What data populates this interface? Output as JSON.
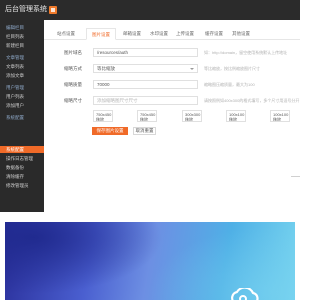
{
  "app": {
    "title": "后台管理系统"
  },
  "sidebar": {
    "items": [
      {
        "label": "编辑栏目",
        "kind": "group"
      },
      {
        "label": "栏目列表",
        "kind": "item"
      },
      {
        "label": "新建栏目",
        "kind": "item"
      },
      {
        "label": "文章管理",
        "kind": "group"
      },
      {
        "label": "文章列表",
        "kind": "item"
      },
      {
        "label": "添加文章",
        "kind": "item"
      },
      {
        "label": "用户管理",
        "kind": "group"
      },
      {
        "label": "用户列表",
        "kind": "item"
      },
      {
        "label": "添加用户",
        "kind": "item"
      },
      {
        "label": "系统配置",
        "kind": "group"
      },
      {
        "label": "系统配置",
        "kind": "active"
      },
      {
        "label": "操作日志管理",
        "kind": "item"
      },
      {
        "label": "数据备份",
        "kind": "item"
      },
      {
        "label": "清除缓存",
        "kind": "item"
      },
      {
        "label": "修改管理员",
        "kind": "item"
      }
    ]
  },
  "tabs": [
    {
      "label": "站点设置",
      "active": false
    },
    {
      "label": "图片设置",
      "active": true
    },
    {
      "label": "邮箱设置",
      "active": false
    },
    {
      "label": "水印设置",
      "active": false
    },
    {
      "label": "上传设置",
      "active": false
    },
    {
      "label": "缓存设置",
      "active": false
    },
    {
      "label": "其他设置",
      "active": false
    }
  ],
  "form": {
    "rows": [
      {
        "label": "图片域名",
        "value": "/resources/auth",
        "placeholder": "",
        "select": false,
        "hint": "如：http://domain，留空使用系统默认上传地址"
      },
      {
        "label": "缩略方式",
        "value": "等比缩放",
        "placeholder": "",
        "select": true,
        "hint": "等比缩放，按比例缩放图片尺寸"
      },
      {
        "label": "缩略质量",
        "value": "70000",
        "placeholder": "",
        "select": false,
        "hint": "缩略图压缩质量，最大为100"
      },
      {
        "label": "缩略尺寸",
        "value": "",
        "placeholder": "添加缩略图尺寸尺寸",
        "select": false,
        "hint": "请按照例如400x300的格式填写，多个尺寸用逗号分开"
      }
    ],
    "sizes": [
      {
        "w": "750x450",
        "h": "移除"
      },
      {
        "w": "750x450",
        "h": "移除"
      },
      {
        "w": "300x300",
        "h": "移除"
      },
      {
        "w": "100x100",
        "h": "移除"
      },
      {
        "w": "100x100",
        "h": "移除"
      }
    ],
    "submit_label": "保存图片设置",
    "reset_label": "取消重置"
  },
  "colors": {
    "accent": "#f06a28",
    "sidebar_bg": "#2a2a2a",
    "topbar_bg": "#2b2b2b"
  },
  "icons": {
    "brand": "square-badge-icon",
    "cloud": "cloud-logo-icon"
  }
}
